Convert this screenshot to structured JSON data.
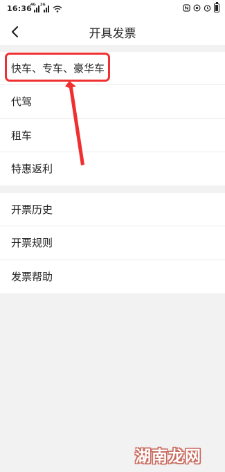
{
  "status_bar": {
    "time": "16:36",
    "sim1": "4G",
    "sim2": "2G",
    "icons": [
      "signal-icon",
      "signal-icon",
      "wifi-icon",
      "nfc-icon",
      "location-icon",
      "alarm-icon",
      "battery-icon"
    ],
    "battery_level": 0.8
  },
  "header": {
    "title": "开具发票",
    "back_icon": "chevron-left-icon"
  },
  "invoice_types": [
    {
      "label": "快车、专车、豪华车"
    },
    {
      "label": "代驾"
    },
    {
      "label": "租车"
    },
    {
      "label": "特惠返利"
    }
  ],
  "invoice_tools": [
    {
      "label": "开票历史"
    },
    {
      "label": "开票规则"
    },
    {
      "label": "发票帮助"
    }
  ],
  "annotation": {
    "color": "#f03030"
  },
  "watermark": {
    "text": "湖南龙网"
  }
}
